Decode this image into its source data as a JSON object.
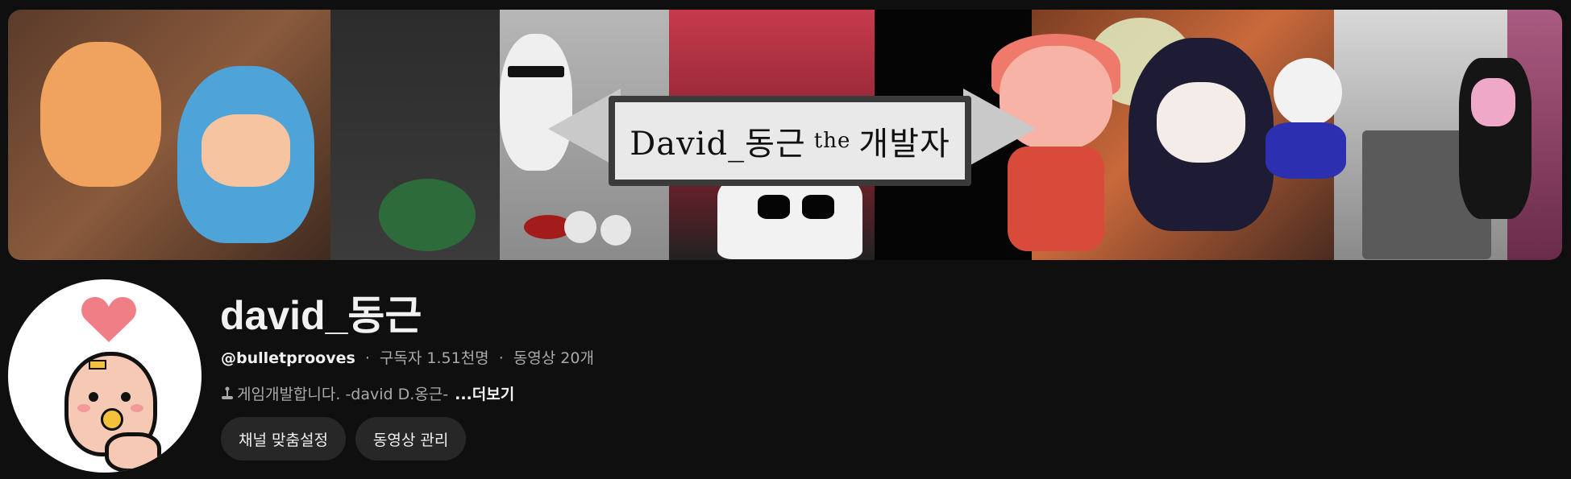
{
  "banner": {
    "title_part1": "David_동근",
    "title_part2": "the",
    "title_part3": "개발자"
  },
  "channel": {
    "name": "david_동근",
    "handle": "@bulletprooves",
    "subscribers": "구독자 1.51천명",
    "videos": "동영상 20개",
    "separator": "·",
    "description": "게임개발합니다. -david D.옹근-",
    "description_icon": "joystick-icon",
    "more_label": "...더보기"
  },
  "buttons": {
    "customize": "채널 맞춤설정",
    "manage_videos": "동영상 관리"
  },
  "colors": {
    "background": "#0f0f0f",
    "button_bg": "#272727",
    "text_primary": "#f1f1f1",
    "text_secondary": "#aaaaaa",
    "heart": "#f07e86"
  }
}
